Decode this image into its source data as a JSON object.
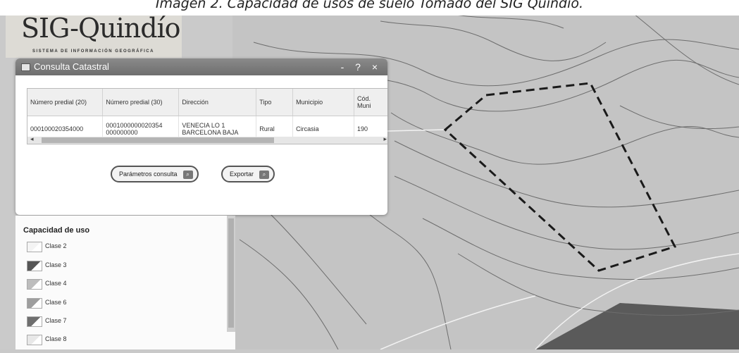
{
  "caption": "Imagen 2. Capacidad de usos de suelo Tomado del SIG Quindío.",
  "logo": {
    "name": "SIG-Quindío",
    "subtitle": "SISTEMA DE INFORMACIÓN GEOGRÁFICA"
  },
  "dialog": {
    "title": "Consulta Catastral",
    "window_controls": "- ? ×",
    "columns": [
      "Número predial (20)",
      "Número predial (30)",
      "Dirección",
      "Tipo",
      "Municipio",
      "Cód. Muni"
    ],
    "rows": [
      [
        "000100020354000",
        "0001000000020354 000000000",
        "VENECIA LO 1 BARCELONA BAJA",
        "Rural",
        "Circasia",
        "190"
      ]
    ],
    "scroll_left": "◂",
    "scroll_right": "▸",
    "buttons": {
      "params": "Parámetros consulta",
      "export": "Exportar"
    }
  },
  "legend": {
    "title": "Capacidad de uso",
    "items": [
      {
        "label": "Clase 2",
        "color": "#f4f4f4"
      },
      {
        "label": "Clase 3",
        "color": "#555555"
      },
      {
        "label": "Clase 4",
        "color": "#bdbdbd"
      },
      {
        "label": "Clase 6",
        "color": "#9e9e9e"
      },
      {
        "label": "Clase 7",
        "color": "#6e6e6e"
      },
      {
        "label": "Clase 8",
        "color": "#e8e8e8"
      }
    ]
  },
  "icons": {
    "title": "window-icon",
    "button": "search-icon"
  }
}
